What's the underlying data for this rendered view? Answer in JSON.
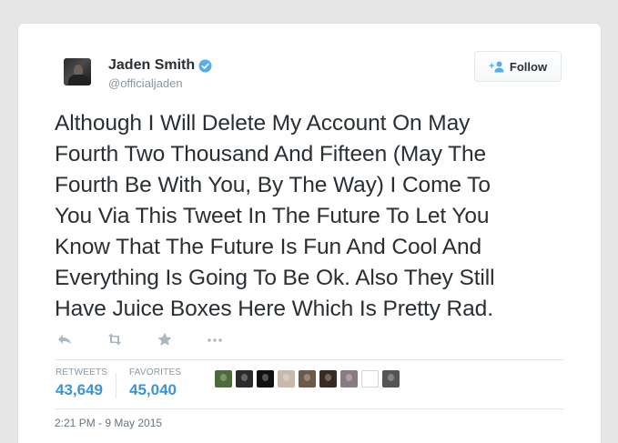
{
  "user": {
    "display_name": "Jaden Smith",
    "handle": "@officialjaden",
    "verified": true,
    "avatar_icon": "profile-photo"
  },
  "follow_button": {
    "label": "Follow",
    "icon": "add-user-icon"
  },
  "tweet": {
    "lines": [
      "Although I Will Delete My Account On May",
      "Fourth Two Thousand And Fifteen (May The",
      "Fourth Be With You, By The Way) I Come To",
      "You Via This Tweet In The Future To Let You",
      "Know That The Future Is Fun And Cool And",
      "Everything Is Going To Be Ok. Also They Still",
      "Have Juice Boxes Here Which Is Pretty Rad."
    ]
  },
  "actions": [
    {
      "name": "reply-icon"
    },
    {
      "name": "retweet-icon"
    },
    {
      "name": "favorite-star-icon"
    },
    {
      "name": "more-options-icon"
    }
  ],
  "stats": {
    "retweets_label": "RETWEETS",
    "retweets_value": "43,649",
    "favorites_label": "FAVORITES",
    "favorites_value": "45,040"
  },
  "favoriter_avatars": [
    {
      "color": "#4b6b3a"
    },
    {
      "color": "#2b2b2b"
    },
    {
      "color": "#111111"
    },
    {
      "color": "#c9b9a8"
    },
    {
      "color": "#6b5a4a"
    },
    {
      "color": "#3a2a22"
    },
    {
      "color": "#8a7a84"
    },
    {
      "color": "#ffffff"
    },
    {
      "color": "#555555"
    }
  ],
  "timestamp": "2:21 PM - 9 May 2015",
  "colors": {
    "link_blue": "#3b94d9",
    "verified_blue": "#55acee",
    "text": "#292f33",
    "muted": "#8899a6",
    "icon_gray": "#aab8c2"
  }
}
